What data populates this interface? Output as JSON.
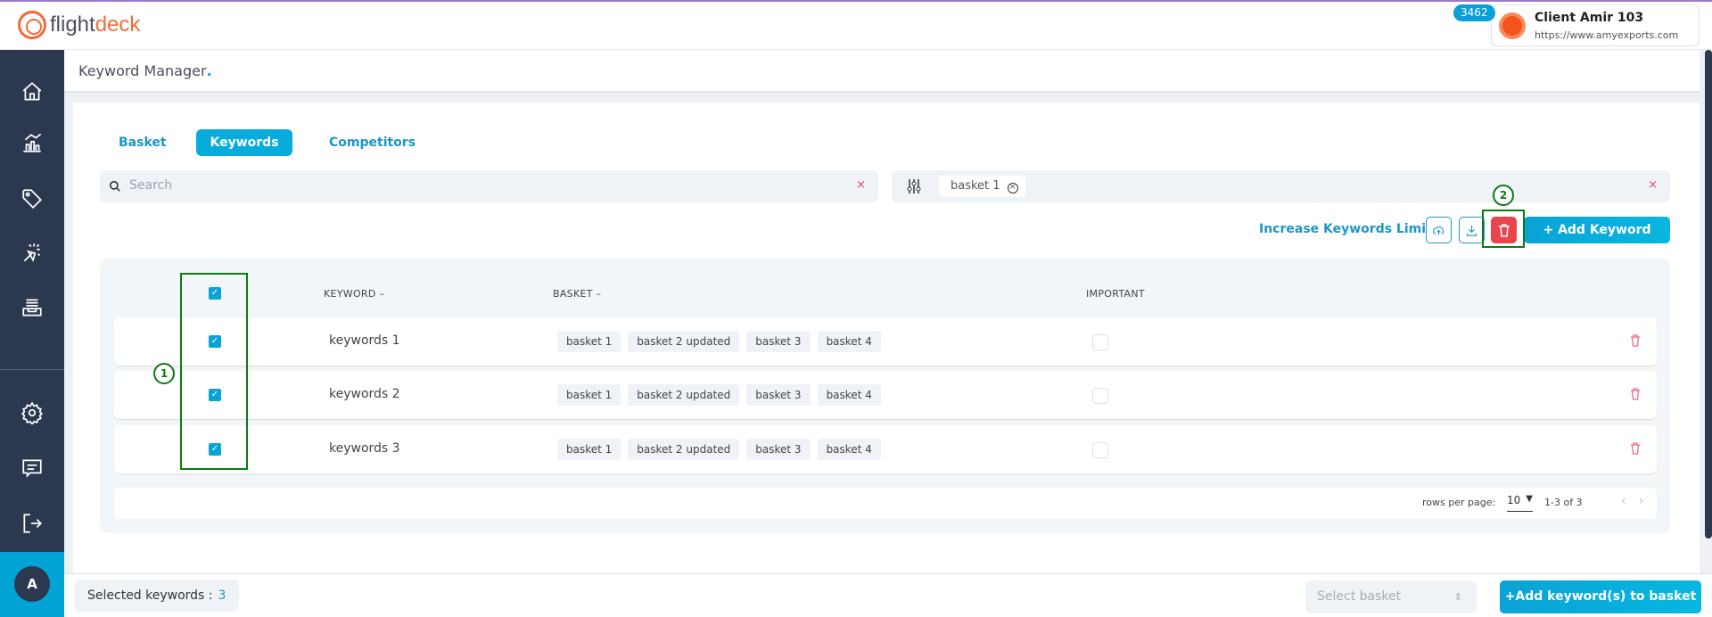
{
  "brand": {
    "logo_text_1": "flight",
    "logo_text_2": "deck"
  },
  "header": {
    "badge": "3462",
    "client_name": "Client Amir 103",
    "client_url": "https://www.amyexports.com"
  },
  "sidebar": {
    "items": [
      "home-icon",
      "analytics-icon",
      "tag-icon",
      "click-icon",
      "inbox-icon",
      "settings-icon",
      "chat-icon",
      "logout-icon"
    ],
    "avatar": "A"
  },
  "page": {
    "title": "Keyword Manager",
    "title_dot": "."
  },
  "tabs": [
    {
      "label": "Basket"
    },
    {
      "label": "Keywords",
      "active": true
    },
    {
      "label": "Competitors"
    }
  ],
  "search": {
    "placeholder": "Search",
    "clear": "×"
  },
  "filter": {
    "chip": "basket 1",
    "clear": "×"
  },
  "actions": {
    "increase_limit": "Increase Keywords Limit",
    "add_keyword": "+  Add Keyword"
  },
  "annotations": {
    "a1": "1",
    "a2": "2"
  },
  "table": {
    "headers": {
      "keyword": "KEYWORD",
      "basket": "BASKET",
      "important": "IMPORTANT",
      "sort": "–"
    },
    "rows": [
      {
        "keyword": "keywords 1",
        "baskets": [
          "basket 1",
          "basket 2 updated",
          "basket 3",
          "basket 4"
        ],
        "checked": true,
        "important": false
      },
      {
        "keyword": "keywords 2",
        "baskets": [
          "basket 1",
          "basket 2 updated",
          "basket 3",
          "basket 4"
        ],
        "checked": true,
        "important": false
      },
      {
        "keyword": "keywords 3",
        "baskets": [
          "basket 1",
          "basket 2 updated",
          "basket 3",
          "basket 4"
        ],
        "checked": true,
        "important": false
      }
    ],
    "pagination": {
      "rows_per_page_label": "rows per page:",
      "rows_per_page": "10",
      "range": "1-3 of 3",
      "prev": "‹",
      "next": "›"
    }
  },
  "footer": {
    "selected_label": "Selected keywords :",
    "selected_count": "3",
    "select_basket_placeholder": "Select basket",
    "add_to_basket": "+Add keyword(s) to basket"
  },
  "colors": {
    "accent": "#0aa3d6",
    "sidebar": "#2b3850",
    "danger": "#e9434b",
    "brand": "#f26b3a"
  }
}
